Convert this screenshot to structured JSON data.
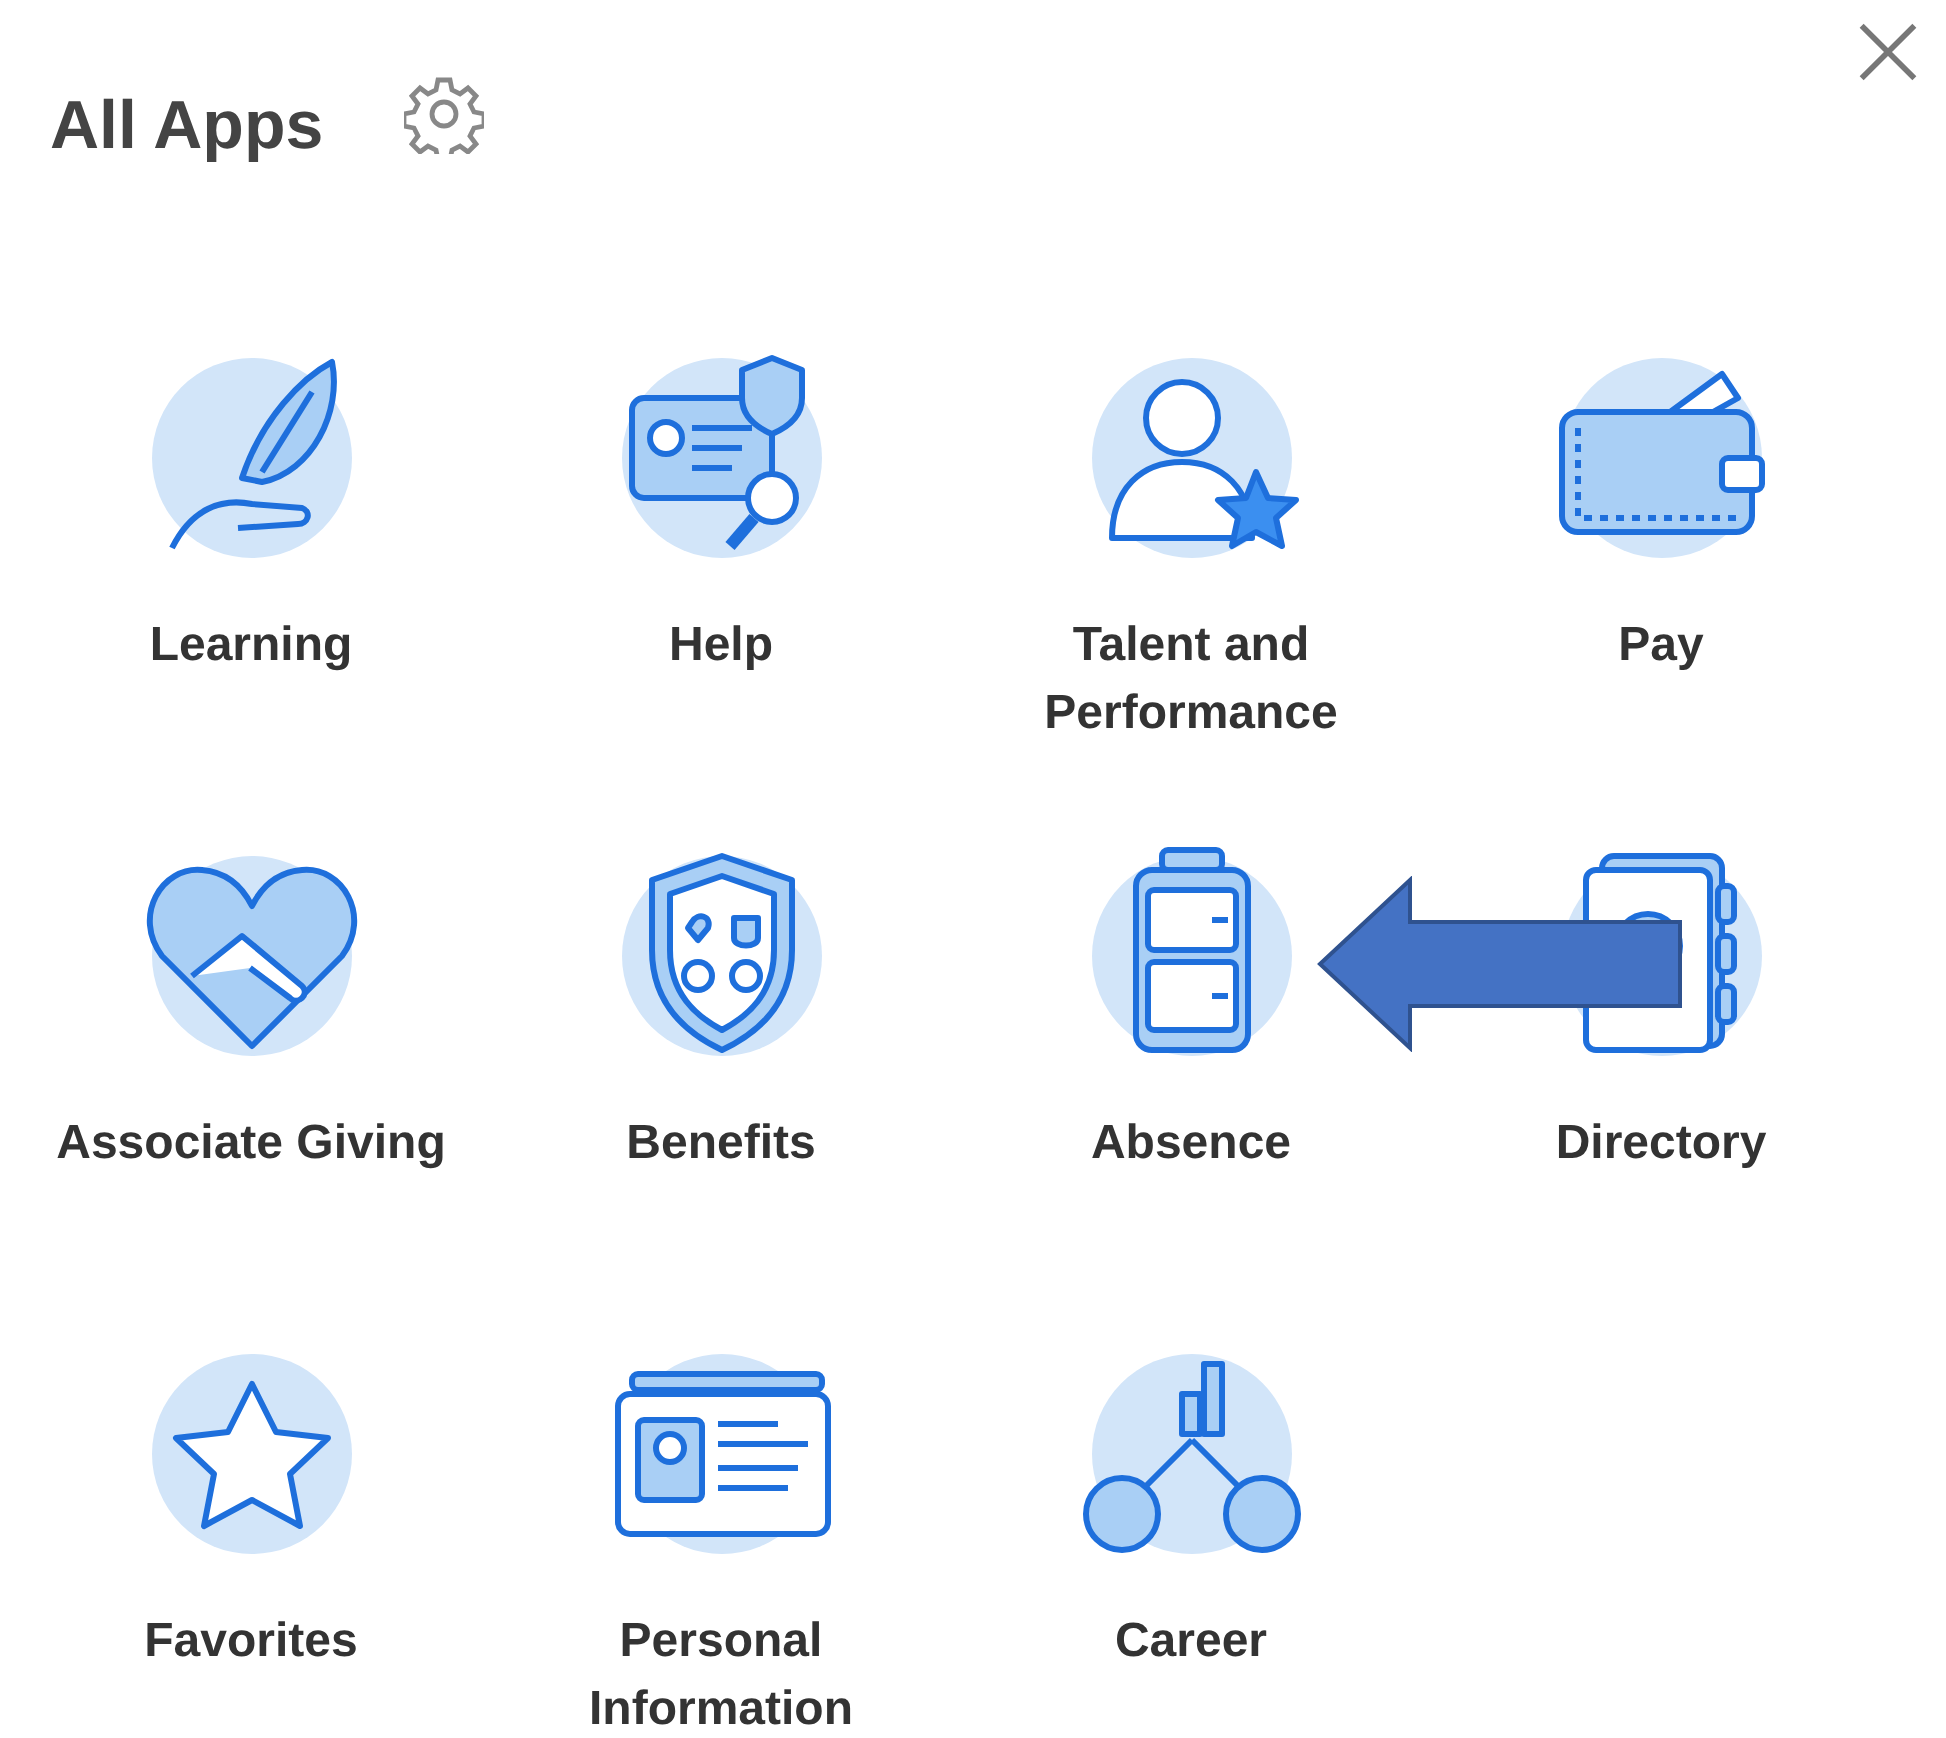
{
  "header": {
    "title": "All Apps"
  },
  "apps": [
    {
      "label": "Learning"
    },
    {
      "label": "Help"
    },
    {
      "label": "Talent and Performance"
    },
    {
      "label": "Pay"
    },
    {
      "label": "Associate Giving"
    },
    {
      "label": "Benefits"
    },
    {
      "label": "Absence"
    },
    {
      "label": "Directory"
    },
    {
      "label": "Favorites"
    },
    {
      "label": "Personal Information"
    },
    {
      "label": "Career"
    }
  ]
}
